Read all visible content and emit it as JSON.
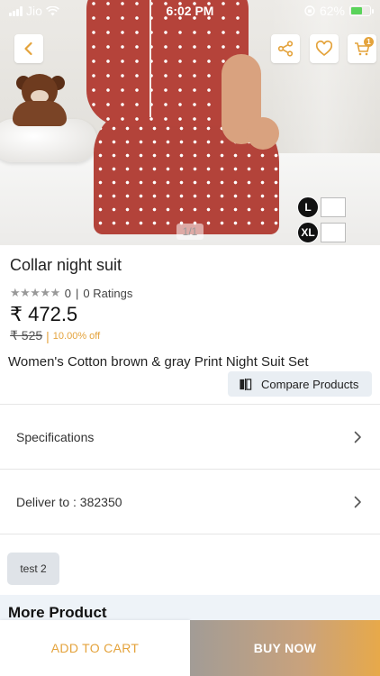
{
  "status_bar": {
    "carrier": "Jio",
    "time": "6:02 PM",
    "battery_percent": "62%"
  },
  "header": {
    "cart_count": "1"
  },
  "gallery": {
    "pager": "1/1",
    "sizes": [
      "L",
      "XL"
    ]
  },
  "product": {
    "title": "Collar night suit",
    "rating_value": "0",
    "ratings_label": "0 Ratings",
    "price": "₹ 472.5",
    "mrp": "₹ 525",
    "separator": "|",
    "discount": "10.00% off",
    "description": "Women's Cotton brown & gray Print Night Suit Set"
  },
  "compare": {
    "label": "Compare Products"
  },
  "rows": {
    "specifications": "Specifications",
    "deliver_to": "Deliver to : 382350"
  },
  "tag": {
    "label": "test 2"
  },
  "more": {
    "title": "More Product"
  },
  "bottom_bar": {
    "add_to_cart": "ADD TO CART",
    "buy_now": "BUY NOW"
  },
  "colors": {
    "accent": "#e4a33c",
    "compare_bg": "#e9eef3",
    "more_bg": "#eef3f8"
  }
}
